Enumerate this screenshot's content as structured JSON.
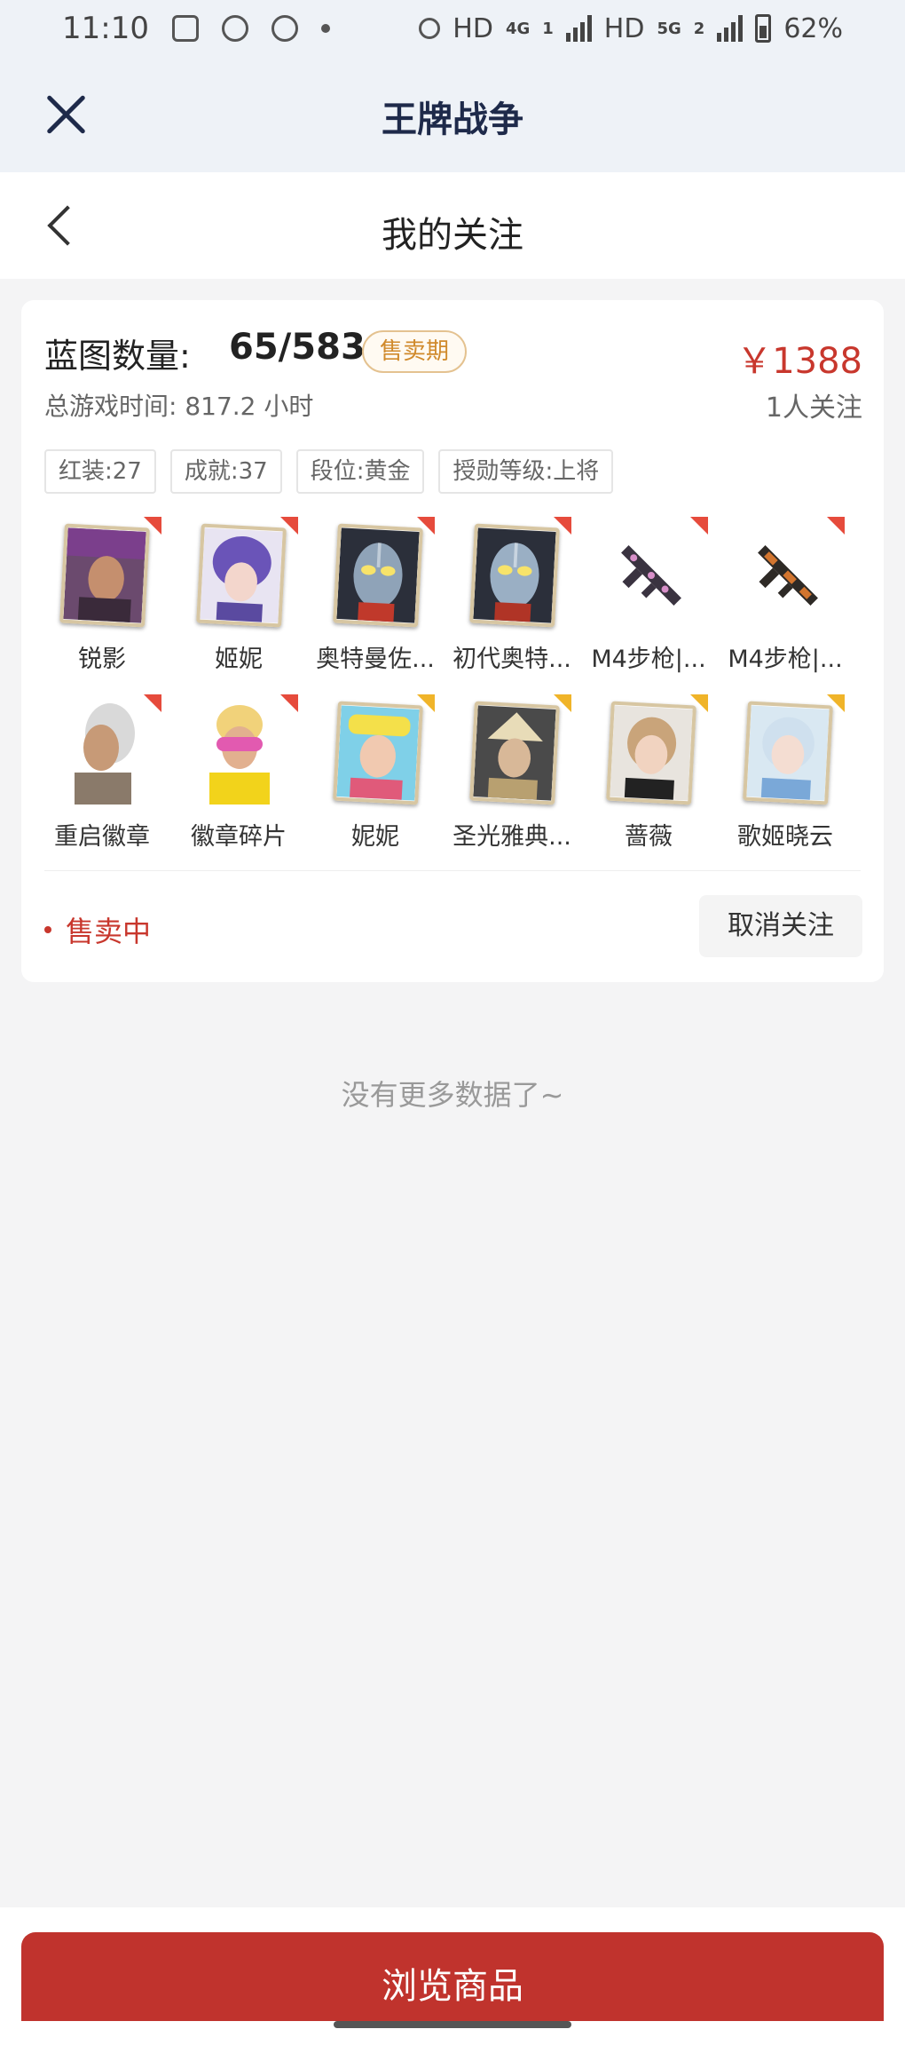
{
  "status_bar": {
    "time": "11:10",
    "hd1": "HD",
    "net1": "4G",
    "hd2": "HD",
    "net2": "5G",
    "badge": "2",
    "sim1": "1",
    "battery": "62%"
  },
  "app_bar": {
    "title": "王牌战争"
  },
  "page": {
    "title": "我的关注"
  },
  "listing": {
    "blueprint_label": "蓝图数量:",
    "blueprint_value": "65/583",
    "status_tag": "售卖期",
    "playtime": "总游戏时间: 817.2 小时",
    "price": "￥1388",
    "followers": "1人关注",
    "tags": [
      "红装:27",
      "成就:37",
      "段位:黄金",
      "授勋等级:上将"
    ],
    "items": [
      {
        "name": "锐影",
        "corner": "red"
      },
      {
        "name": "姬妮",
        "corner": "red"
      },
      {
        "name": "奥特曼佐...",
        "corner": "red"
      },
      {
        "name": "初代奥特...",
        "corner": "red"
      },
      {
        "name": "M4步枪|...",
        "corner": "red"
      },
      {
        "name": "M4步枪|...",
        "corner": "red"
      },
      {
        "name": "重启徽章",
        "corner": "red"
      },
      {
        "name": "徽章碎片",
        "corner": "red"
      },
      {
        "name": "妮妮",
        "corner": "gold"
      },
      {
        "name": "圣光雅典...",
        "corner": "gold"
      },
      {
        "name": "蔷薇",
        "corner": "gold"
      },
      {
        "name": "歌姬晓云",
        "corner": "gold"
      }
    ],
    "selling_status": "售卖中",
    "unfollow_label": "取消关注"
  },
  "list_end_text": "没有更多数据了~",
  "bottom": {
    "browse_label": "浏览商品"
  },
  "colors": {
    "accent_red": "#c8372d",
    "tag_gold": "#d08a2c",
    "button_red": "#c0332d"
  }
}
